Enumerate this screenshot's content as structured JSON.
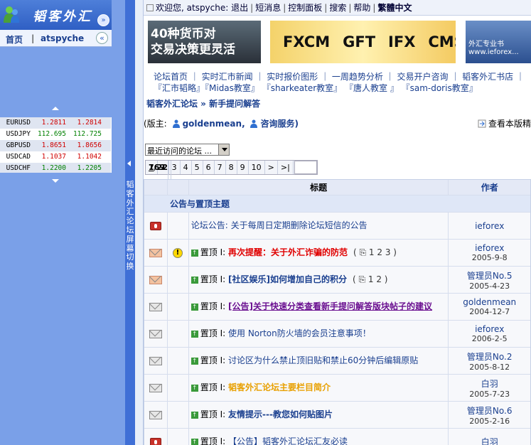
{
  "sidebar": {
    "logo_text": "韬客外汇",
    "nav_home": "首页",
    "nav_sep": "|",
    "nav_user": "atspyche",
    "collapse_glyph": "«",
    "fold_glyph": "»",
    "rates": [
      {
        "pair": "EURUSD",
        "bid": "1.2811",
        "ask": "1.2814",
        "color": "dn"
      },
      {
        "pair": "USDJPY",
        "bid": "112.695",
        "ask": "112.725",
        "color": "up"
      },
      {
        "pair": "GBPUSD",
        "bid": "1.8651",
        "ask": "1.8656",
        "color": "dn"
      },
      {
        "pair": "USDCAD",
        "bid": "1.1037",
        "ask": "1.1042",
        "color": "dn"
      },
      {
        "pair": "USDCHF",
        "bid": "1.2200",
        "ask": "1.2205",
        "color": "up"
      }
    ],
    "vertical_text": "韬客外汇论坛屏幕切换"
  },
  "topbar": {
    "welcome": "欢迎您, atspyche:",
    "items": [
      "退出",
      "短消息",
      "控制面板",
      "搜索",
      "帮助",
      "繁體中文"
    ],
    "sep": "|"
  },
  "banners": {
    "b1_line1": "40种货币对",
    "b1_line2": "交易决策更灵活",
    "b2_items": [
      "FXCM",
      "GFT",
      "IFX",
      "CMS"
    ],
    "b3_text": "外汇专业书 www.ieforex..."
  },
  "links": {
    "row1": "论坛首页 ｜ 实时汇市新闻 ｜ 实时报价图形 ｜ 一周趋势分析 ｜ 交易开户咨询 ｜ 韬客外汇书店 ｜",
    "row2": "『汇市韬略』『Midas教室』 『sharkeater教室』 『唐人教室 』 『sam-doris教室』"
  },
  "breadcrumb": "韬客外汇论坛 » 新手提问解答",
  "moderators": {
    "label": "(版主:",
    "mod1": "goldenmean,",
    "mod2": "咨询服务)",
    "view_board": "查看本版精"
  },
  "recent_select": "最近访问的论坛 ...",
  "pager": {
    "total": "769",
    "pos": "1/22",
    "pages": [
      "1",
      "2",
      "3",
      "4",
      "5",
      "6",
      "7",
      "8",
      "9",
      "10"
    ],
    "next": ">",
    "last": ">|"
  },
  "table": {
    "col_title": "标题",
    "col_author": "作者",
    "section": "公告与置顶主题",
    "rows": [
      {
        "icon": "bell",
        "title": "论坛公告: 关于每周日定期删除论坛短信的公告",
        "style": "plain",
        "prefix": "",
        "pages": "",
        "author": "ieforex",
        "date": ""
      },
      {
        "icon": "env-o",
        "warn": true,
        "prefix": "置顶 I:",
        "title": "再次提醒：关于外汇诈骗的防范",
        "style": "red",
        "pages": "( ⎘ 1 2 3 )",
        "author": "ieforex",
        "date": "2005-9-8"
      },
      {
        "icon": "env-o",
        "prefix": "置顶 I:",
        "title": "[社区娱乐]如何增加自己的积分",
        "style": "blue",
        "pages": "( ⎘ 1 2 )",
        "author": "管理员No.5",
        "date": "2005-4-23"
      },
      {
        "icon": "env",
        "prefix": "置顶 I:",
        "title": "[公告]关于快速分类查看新手提问解答版块帖子的建议",
        "style": "pur",
        "pages": "",
        "author": "goldenmean",
        "date": "2004-12-7"
      },
      {
        "icon": "env",
        "prefix": "置顶 I:",
        "title": "使用 Norton防火墙的会员注意事项！",
        "style": "plain",
        "pages": "",
        "author": "ieforex",
        "date": "2006-2-5"
      },
      {
        "icon": "env",
        "prefix": "置顶 I:",
        "title": "讨论区为什么禁止顶旧贴和禁止60分钟后编辑原贴",
        "style": "plain",
        "pages": "",
        "author": "管理员No.2",
        "date": "2005-8-12"
      },
      {
        "icon": "env",
        "prefix": "置顶 I:",
        "title": "韬客外汇论坛主要栏目简介",
        "style": "org",
        "pages": "",
        "author": "白羽",
        "date": "2005-7-23"
      },
      {
        "icon": "env",
        "prefix": "置顶 I:",
        "title": "友情提示---教您如何贴图片",
        "style": "blue",
        "pages": "",
        "author": "管理员No.6",
        "date": "2005-2-16"
      },
      {
        "icon": "bell",
        "prefix": "置顶 I:",
        "title": "【公告】韬客外汇论坛汇友必读",
        "style": "plain",
        "pages": "",
        "author": "白羽",
        "date": ""
      }
    ]
  }
}
